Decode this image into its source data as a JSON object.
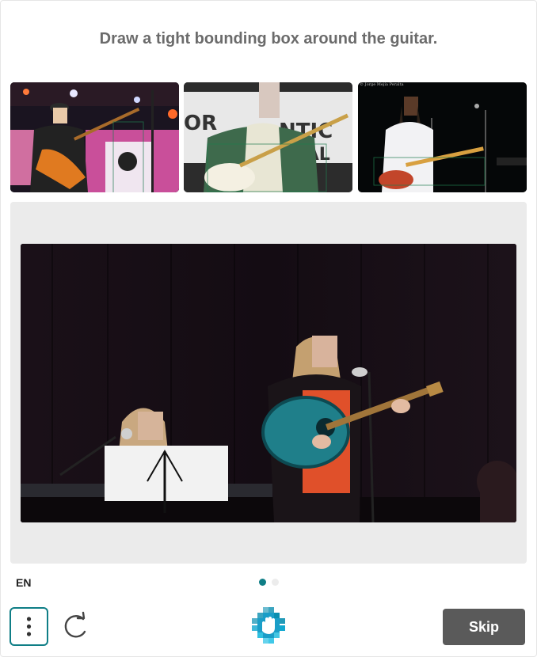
{
  "prompt": {
    "text": "Draw a tight bounding box around the guitar."
  },
  "examples": [
    {
      "caption": ""
    },
    {
      "caption": ""
    },
    {
      "caption": "© Jorge Mejía Peralta"
    }
  ],
  "footer": {
    "language": "EN",
    "skip_label": "Skip",
    "page_current": 1,
    "page_total": 2
  },
  "icons": {
    "menu": "vertical-dots-icon",
    "refresh": "refresh-icon",
    "logo": "hand-logo-icon"
  },
  "colors": {
    "accent": "#0f7e86",
    "skip_button": "#5a5a5a",
    "prompt_text": "#6b6b6b",
    "canvas_bg": "#ebebeb"
  }
}
